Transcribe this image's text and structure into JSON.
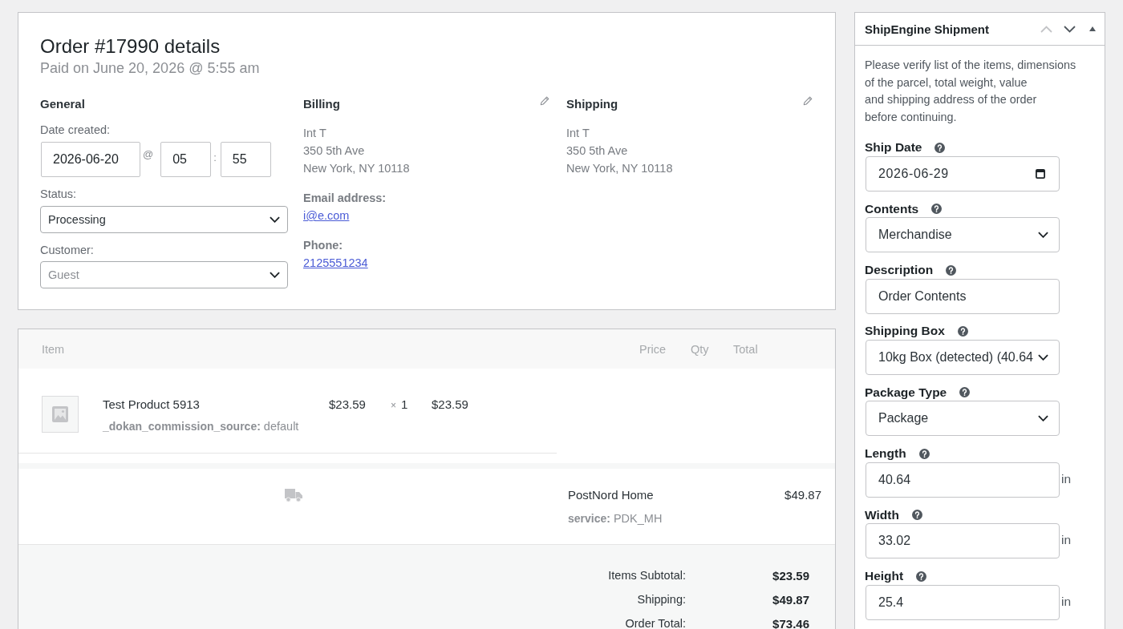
{
  "order": {
    "title": "Order #17990 details",
    "subtitle": "Paid on June 20, 2026 @ 5:55 am"
  },
  "general": {
    "heading": "General",
    "date_label": "Date created:",
    "date": "2026-06-20",
    "date_separator": "@",
    "hour": "05",
    "time_separator": ":",
    "minute": "55",
    "status_label": "Status:",
    "status": "Processing",
    "customer_label": "Customer:",
    "customer_placeholder": "Guest"
  },
  "billing": {
    "heading": "Billing",
    "address_lines": [
      "Int T",
      "350 5th Ave",
      "New York, NY 10118"
    ],
    "email_label": "Email address:",
    "email": "i@e.com",
    "phone_label": "Phone:",
    "phone": "2125551234"
  },
  "shipping": {
    "heading": "Shipping",
    "address_lines": [
      "Int T",
      "350 5th Ave",
      "New York, NY 10118"
    ]
  },
  "items_table": {
    "columns": [
      "Item",
      "Price",
      "Qty",
      "Total"
    ],
    "rows": [
      {
        "name": "Test Product 5913",
        "meta": [
          {
            "key": "_dokan_commission_source:",
            "value": "default"
          }
        ],
        "price": "$23.59",
        "qty_prefix": "×",
        "qty": "1",
        "total": "$23.59"
      }
    ]
  },
  "shipping_line": {
    "method": "PostNord Home",
    "meta": [
      {
        "key": "service:",
        "value": "PDK_MH"
      }
    ],
    "cost": "$49.87"
  },
  "totals": [
    {
      "label": "Items Subtotal:",
      "value": "$23.59"
    },
    {
      "label": "Shipping:",
      "value": "$49.87"
    },
    {
      "label": "Order Total:",
      "value": "$73.46"
    }
  ],
  "shipengine_panel": {
    "title": "ShipEngine Shipment",
    "move_up": {
      "disabled": true
    },
    "move_down": {
      "disabled": false
    },
    "expanded": true,
    "description_lines": [
      "Please verify list of the items, dimensions",
      "of the parcel, total weight, value",
      "and shipping address of the order",
      "before continuing."
    ],
    "fields": [
      {
        "kind": "date",
        "label": "Ship Date",
        "value": "2026-06-29"
      },
      {
        "kind": "select",
        "label": "Contents",
        "value": "Merchandise"
      },
      {
        "kind": "text",
        "label": "Description",
        "value": "Order Contents"
      },
      {
        "kind": "select",
        "label": "Shipping Box",
        "value": "10kg Box (detected) (40.64"
      },
      {
        "kind": "select",
        "label": "Package Type",
        "value": "Package"
      },
      {
        "kind": "number",
        "label": "Length",
        "value": "40.64",
        "unit": "in"
      },
      {
        "kind": "number",
        "label": "Width",
        "value": "33.02",
        "unit": "in"
      },
      {
        "kind": "number",
        "label": "Height",
        "value": "25.4",
        "unit": "in"
      }
    ]
  }
}
